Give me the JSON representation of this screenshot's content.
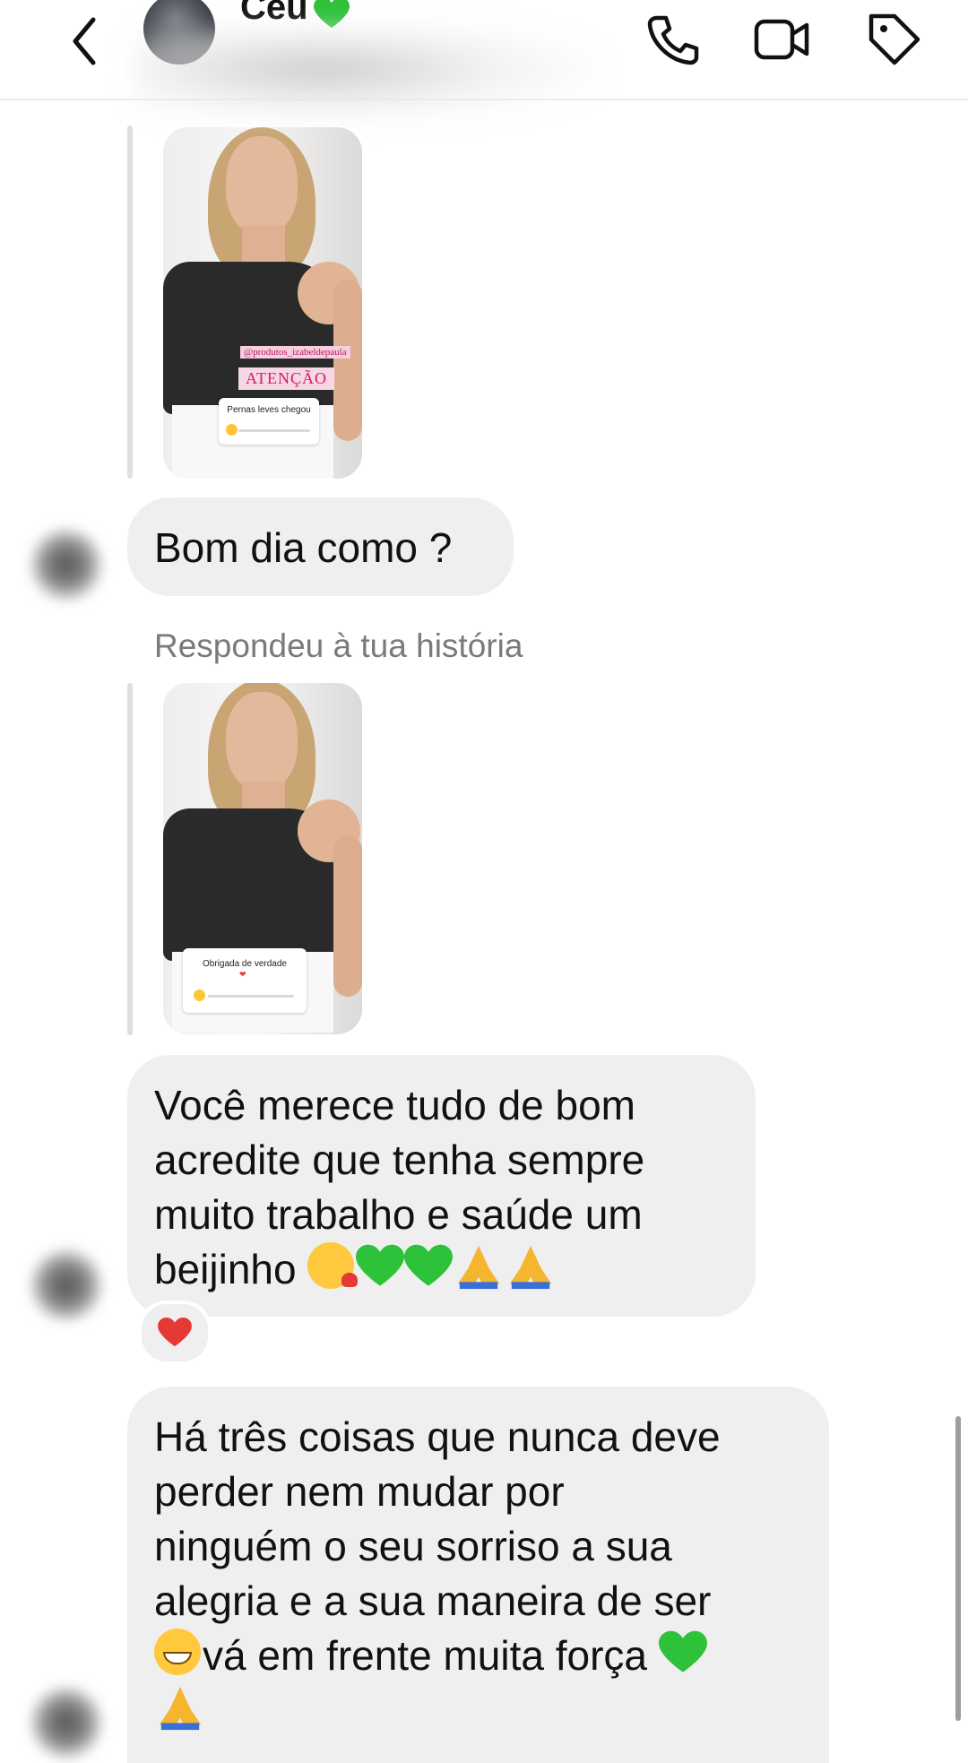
{
  "header": {
    "contact_name": "Céu",
    "name_emoji": "green-heart",
    "back_icon": "chevron-left-icon",
    "actions": [
      "phone-icon",
      "video-camera-icon",
      "tag-icon"
    ]
  },
  "chat": {
    "story_1": {
      "mention": "@produtos_izabeldepaula",
      "headline": "ATENÇÃO",
      "slider_question": "Pernas leves chegou"
    },
    "message_1": "Bom dia como ?",
    "replied_label": "Respondeu à tua história",
    "story_2": {
      "slider_question": "Obrigada de verdade"
    },
    "message_2": {
      "lines": [
        "Você merece tudo de bom",
        "acredite que tenha sempre",
        "muito trabalho e saúde um",
        "beijinho"
      ],
      "trailing_emojis": [
        "kissing-face",
        "green-heart",
        "green-heart",
        "folded-hands",
        "folded-hands"
      ],
      "reaction": "red-heart"
    },
    "message_3": {
      "lines": [
        "Há três coisas que nunca deve",
        "perder nem mudar por",
        "ninguém o seu sorriso a sua",
        "alegria e a sua maneira de ser"
      ],
      "line5_text": "vá em frente muita força",
      "emojis": [
        "grinning-face",
        "green-heart",
        "folded-hands"
      ]
    }
  },
  "colors": {
    "bubble": "#efefef",
    "label": "#7a7a7a",
    "green_heart": "#2ec13a",
    "red_heart": "#e53935",
    "folded_hands": "#f5b52e"
  }
}
